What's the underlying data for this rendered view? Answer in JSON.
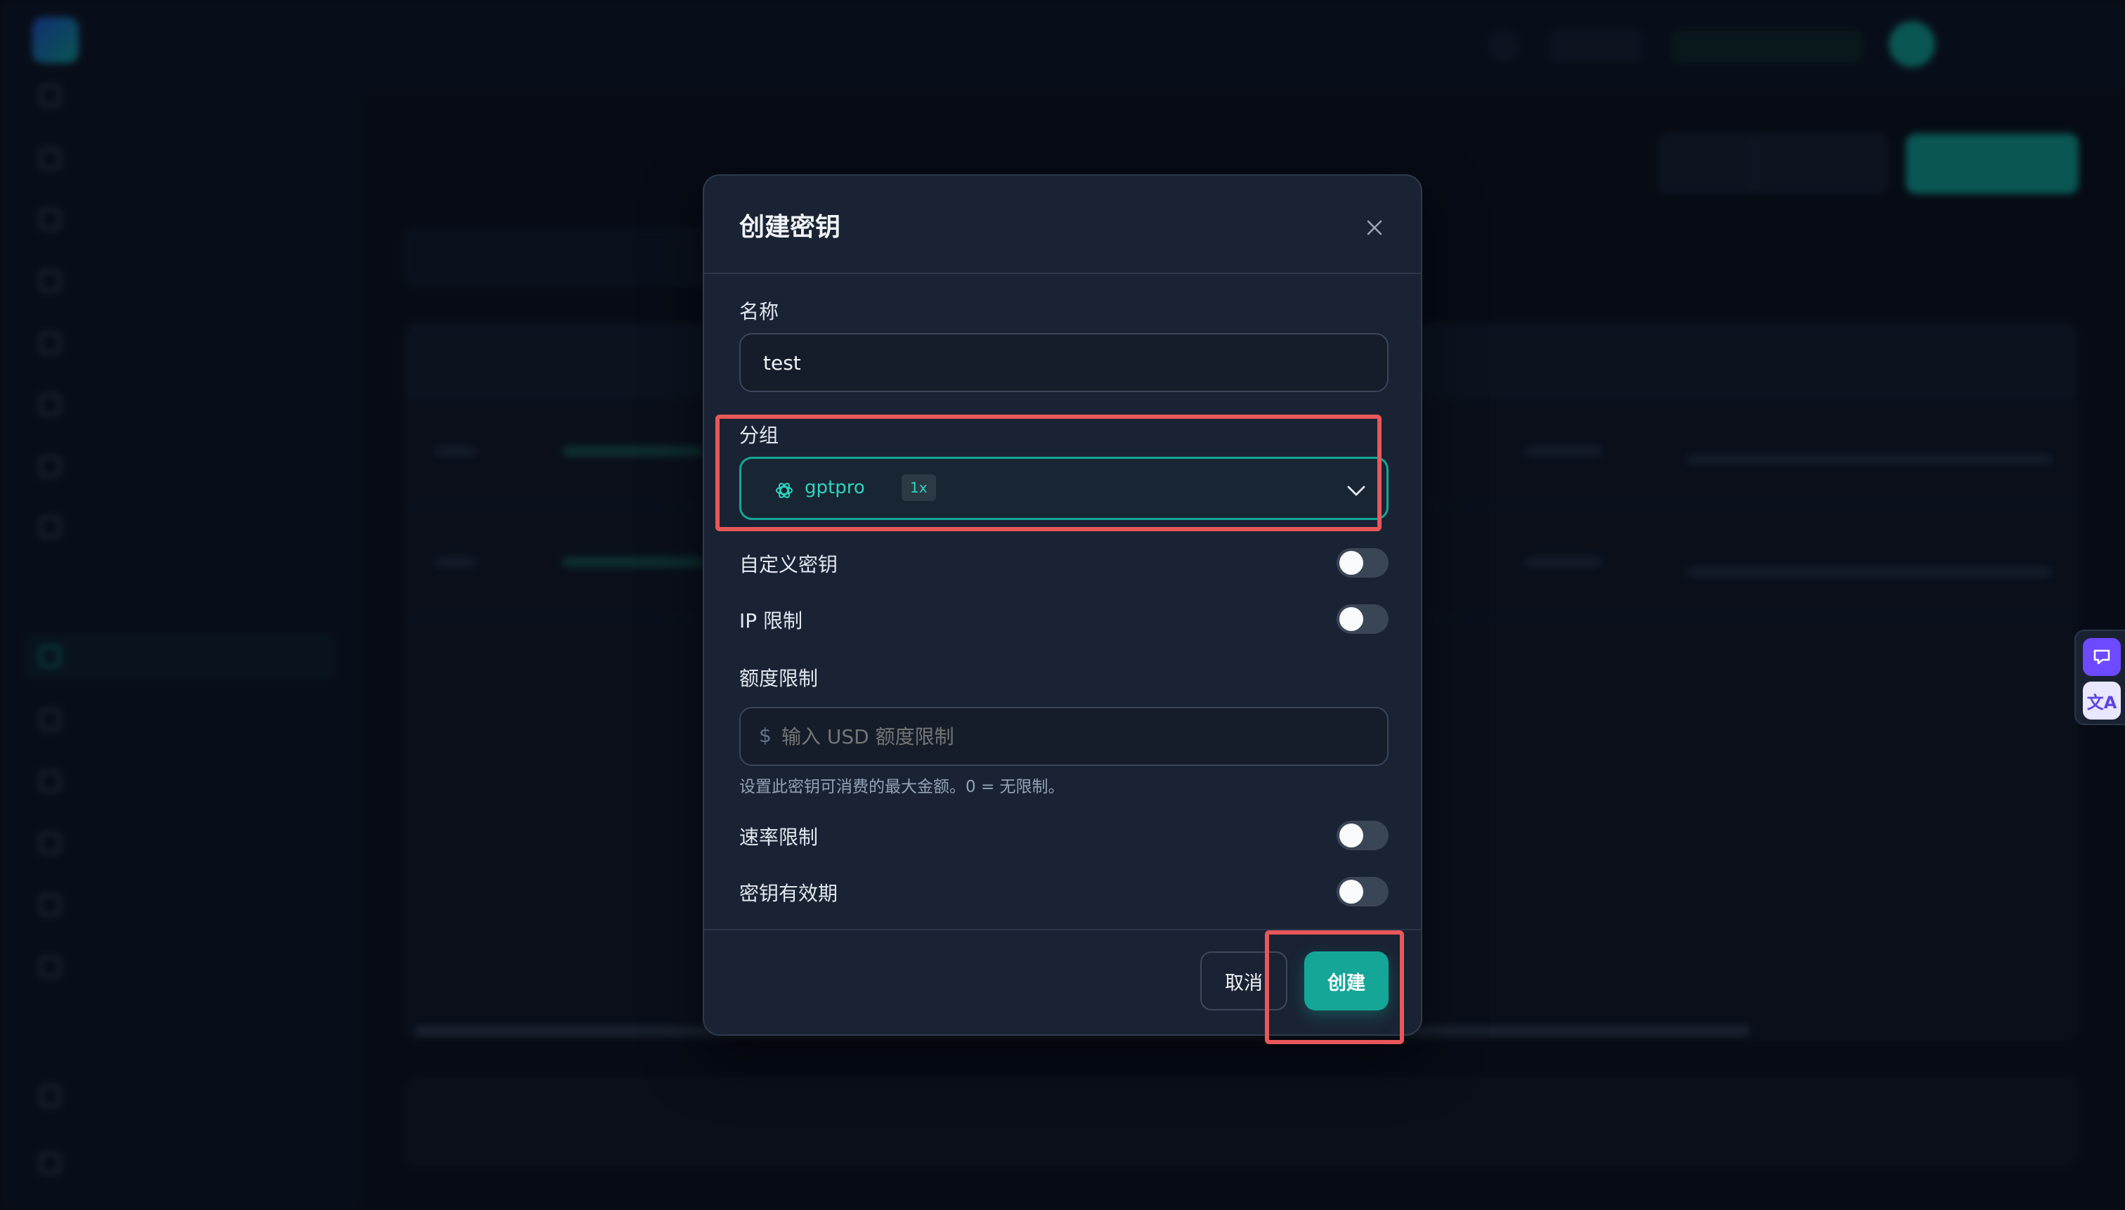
{
  "modal": {
    "title": "创建密钥",
    "name_label": "名称",
    "name_value": "test",
    "group_label": "分组",
    "group_value": "gptpro",
    "group_badge": "1x",
    "custom_key_label": "自定义密钥",
    "ip_limit_label": "IP 限制",
    "quota_label": "额度限制",
    "quota_currency": "$",
    "quota_placeholder": "输入 USD 额度限制",
    "quota_help": "设置此密钥可消费的最大金额。0 = 无限制。",
    "rate_limit_label": "速率限制",
    "expiry_label": "密钥有效期",
    "cancel_label": "取消",
    "create_label": "创建"
  },
  "toggles": {
    "custom_key": false,
    "ip_limit": false,
    "rate_limit": false,
    "expiry": false
  },
  "side_widget": {
    "translate_glyph": "文A"
  },
  "colors": {
    "accent": "#14a697",
    "accent_text": "#2dd4bf",
    "highlight": "#e8575a",
    "modal_bg": "#1a2333"
  },
  "icons": {
    "close": "close-icon",
    "group": "openai-icon",
    "chevron": "chevron-down-icon"
  }
}
